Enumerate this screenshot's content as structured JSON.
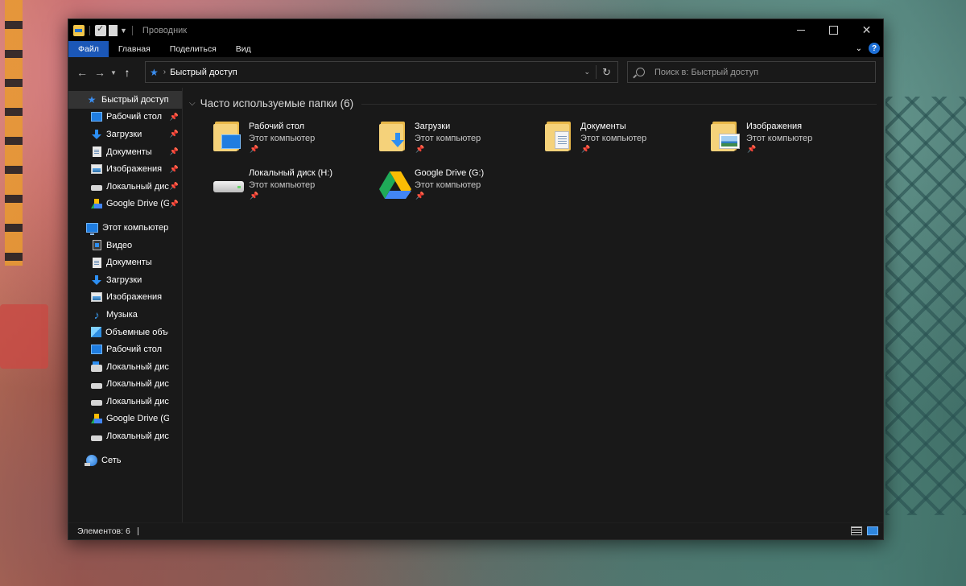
{
  "window": {
    "title": "Проводник",
    "controls": {
      "minimize": "",
      "maximize": "",
      "close": "✕"
    }
  },
  "ribbon": {
    "tabs": [
      {
        "label": "Файл",
        "active": true
      },
      {
        "label": "Главная"
      },
      {
        "label": "Поделиться"
      },
      {
        "label": "Вид"
      }
    ],
    "expand_icon": "chevron-down-icon",
    "help_label": "?"
  },
  "navigation": {
    "address": {
      "location": "Быстрый доступ",
      "icon": "quick-access-star-icon"
    },
    "search": {
      "placeholder": "Поиск в: Быстрый доступ"
    }
  },
  "sidebar": {
    "quick_access": {
      "label": "Быстрый доступ",
      "items": [
        {
          "label": "Рабочий стол",
          "icon": "desktop-icon",
          "pinned": true
        },
        {
          "label": "Загрузки",
          "icon": "downloads-icon",
          "pinned": true
        },
        {
          "label": "Документы",
          "icon": "documents-icon",
          "pinned": true
        },
        {
          "label": "Изображения",
          "icon": "pictures-icon",
          "pinned": true
        },
        {
          "label": "Локальный диск (H:)",
          "icon": "drive-icon",
          "pinned": true
        },
        {
          "label": "Google Drive (G:)",
          "icon": "google-drive-icon",
          "pinned": true
        }
      ]
    },
    "this_pc": {
      "label": "Этот компьютер",
      "items": [
        {
          "label": "Видео",
          "icon": "videos-icon"
        },
        {
          "label": "Документы",
          "icon": "documents-icon"
        },
        {
          "label": "Загрузки",
          "icon": "downloads-icon"
        },
        {
          "label": "Изображения",
          "icon": "pictures-icon"
        },
        {
          "label": "Музыка",
          "icon": "music-icon"
        },
        {
          "label": "Объемные объекты",
          "icon": "3d-objects-icon"
        },
        {
          "label": "Рабочий стол",
          "icon": "desktop-icon"
        },
        {
          "label": "Локальный диск (C:)",
          "icon": "system-drive-icon"
        },
        {
          "label": "Локальный диск (D:)",
          "icon": "drive-icon"
        },
        {
          "label": "Локальный диск (E:)",
          "icon": "drive-icon"
        },
        {
          "label": "Google Drive (G:)",
          "icon": "google-drive-icon"
        },
        {
          "label": "Локальный диск (H:)",
          "icon": "drive-icon"
        }
      ]
    },
    "network": {
      "label": "Сеть",
      "icon": "network-icon"
    },
    "pin_glyph": "📌"
  },
  "content": {
    "group": {
      "title": "Часто используемые папки (6)"
    },
    "tiles": [
      {
        "name": "Рабочий стол",
        "location": "Этот компьютер",
        "icon": "desktop-folder-icon"
      },
      {
        "name": "Загрузки",
        "location": "Этот компьютер",
        "icon": "downloads-folder-icon"
      },
      {
        "name": "Документы",
        "location": "Этот компьютер",
        "icon": "documents-folder-icon"
      },
      {
        "name": "Изображения",
        "location": "Этот компьютер",
        "icon": "pictures-folder-icon"
      },
      {
        "name": "Локальный диск (H:)",
        "location": "Этот компьютер",
        "icon": "drive-icon"
      },
      {
        "name": "Google Drive (G:)",
        "location": "Этот компьютер",
        "icon": "google-drive-icon"
      }
    ]
  },
  "status": {
    "items_count": "Элементов: 6"
  },
  "colors": {
    "accent": "#1b57b7",
    "folder": "#f5d27a",
    "background": "#191919",
    "titlebar": "#000000"
  }
}
